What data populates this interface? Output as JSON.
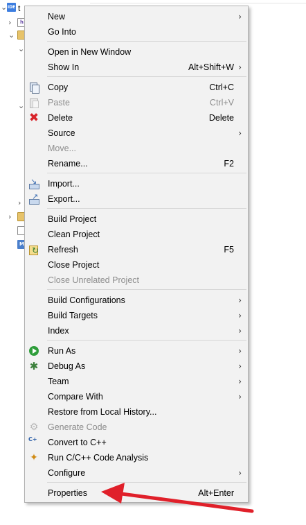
{
  "tree": {
    "root_icon_text": "IDE",
    "root_label": "t",
    "chevrons": [
      "⌄",
      "›",
      "⌄",
      "⌄",
      "⌄",
      "›"
    ]
  },
  "menu": {
    "items": [
      {
        "label": "New",
        "accel": "",
        "submenu": true,
        "disabled": false,
        "icon": ""
      },
      {
        "label": "Go Into",
        "accel": "",
        "submenu": false,
        "disabled": false,
        "icon": ""
      },
      {
        "label": "Open in New Window",
        "accel": "",
        "submenu": false,
        "disabled": false,
        "icon": ""
      },
      {
        "label": "Show In",
        "accel": "Alt+Shift+W",
        "submenu": true,
        "disabled": false,
        "icon": ""
      },
      {
        "label": "Copy",
        "accel": "Ctrl+C",
        "submenu": false,
        "disabled": false,
        "icon": "copy-icon"
      },
      {
        "label": "Paste",
        "accel": "Ctrl+V",
        "submenu": false,
        "disabled": true,
        "icon": "paste-icon"
      },
      {
        "label": "Delete",
        "accel": "Delete",
        "submenu": false,
        "disabled": false,
        "icon": "delete-icon"
      },
      {
        "label": "Source",
        "accel": "",
        "submenu": true,
        "disabled": false,
        "icon": ""
      },
      {
        "label": "Move...",
        "accel": "",
        "submenu": false,
        "disabled": true,
        "icon": ""
      },
      {
        "label": "Rename...",
        "accel": "F2",
        "submenu": false,
        "disabled": false,
        "icon": ""
      },
      {
        "label": "Import...",
        "accel": "",
        "submenu": false,
        "disabled": false,
        "icon": "import-icon"
      },
      {
        "label": "Export...",
        "accel": "",
        "submenu": false,
        "disabled": false,
        "icon": "export-icon"
      },
      {
        "label": "Build Project",
        "accel": "",
        "submenu": false,
        "disabled": false,
        "icon": ""
      },
      {
        "label": "Clean Project",
        "accel": "",
        "submenu": false,
        "disabled": false,
        "icon": ""
      },
      {
        "label": "Refresh",
        "accel": "F5",
        "submenu": false,
        "disabled": false,
        "icon": "refresh-icon"
      },
      {
        "label": "Close Project",
        "accel": "",
        "submenu": false,
        "disabled": false,
        "icon": ""
      },
      {
        "label": "Close Unrelated Project",
        "accel": "",
        "submenu": false,
        "disabled": true,
        "icon": ""
      },
      {
        "label": "Build Configurations",
        "accel": "",
        "submenu": true,
        "disabled": false,
        "icon": ""
      },
      {
        "label": "Build Targets",
        "accel": "",
        "submenu": true,
        "disabled": false,
        "icon": ""
      },
      {
        "label": "Index",
        "accel": "",
        "submenu": true,
        "disabled": false,
        "icon": ""
      },
      {
        "label": "Run As",
        "accel": "",
        "submenu": true,
        "disabled": false,
        "icon": "run-icon"
      },
      {
        "label": "Debug As",
        "accel": "",
        "submenu": true,
        "disabled": false,
        "icon": "debug-icon"
      },
      {
        "label": "Team",
        "accel": "",
        "submenu": true,
        "disabled": false,
        "icon": ""
      },
      {
        "label": "Compare With",
        "accel": "",
        "submenu": true,
        "disabled": false,
        "icon": ""
      },
      {
        "label": "Restore from Local History...",
        "accel": "",
        "submenu": false,
        "disabled": false,
        "icon": ""
      },
      {
        "label": "Generate Code",
        "accel": "",
        "submenu": false,
        "disabled": true,
        "icon": "generate-code-icon"
      },
      {
        "label": "Convert to C++",
        "accel": "",
        "submenu": false,
        "disabled": false,
        "icon": "convert-cpp-icon"
      },
      {
        "label": "Run C/C++ Code Analysis",
        "accel": "",
        "submenu": false,
        "disabled": false,
        "icon": "code-analysis-icon"
      },
      {
        "label": "Configure",
        "accel": "",
        "submenu": true,
        "disabled": false,
        "icon": ""
      },
      {
        "label": "Properties",
        "accel": "Alt+Enter",
        "submenu": false,
        "disabled": false,
        "icon": ""
      }
    ]
  },
  "submenu_glyph": "›",
  "colors": {
    "menu_bg": "#f2f2f2",
    "disabled_text": "#8d8d8d",
    "annotation_arrow": "#e0202a"
  }
}
